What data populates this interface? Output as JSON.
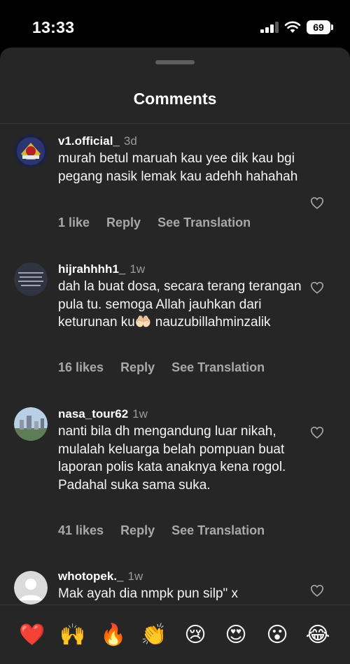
{
  "status_bar": {
    "time": "13:33",
    "battery": "69"
  },
  "sheet": {
    "title": "Comments"
  },
  "comments": [
    {
      "username": "v1.official_",
      "age": "3d",
      "text": "murah betul maruah kau yee dik kau bgi pegang nasik lemak kau adehh hahahah",
      "likes": "1 like",
      "reply": "Reply",
      "translate": "See Translation"
    },
    {
      "username": "hijrahhhh1_",
      "age": "1w",
      "text": "dah la buat dosa, secara terang terangan pula tu. semoga Allah jauhkan dari keturunan ku🤲🏻 nauzubillahminzalik",
      "likes": "16 likes",
      "reply": "Reply",
      "translate": "See Translation"
    },
    {
      "username": "nasa_tour62",
      "age": "1w",
      "text": "nanti bila dh mengandung luar nikah, mulalah keluarga belah pompuan buat laporan polis kata anaknya kena rogol. Padahal suka sama suka.",
      "likes": "41 likes",
      "reply": "Reply",
      "translate": "See Translation"
    },
    {
      "username": "whotopek._",
      "age": "1w",
      "text": "Mak ayah dia nmpk pun silp\" x",
      "likes": "",
      "reply": "",
      "translate": ""
    }
  ],
  "emojis": [
    "❤️",
    "🙌",
    "🔥",
    "👏",
    "😢",
    "😍",
    "😮",
    "😂"
  ]
}
